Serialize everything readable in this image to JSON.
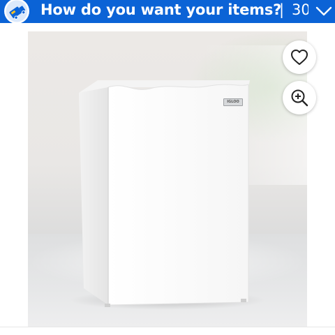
{
  "banner": {
    "question": "How do you want your items?",
    "separator": "|",
    "date_fragment": "30",
    "background_color": "#0b63d6",
    "icon": "delivery-truck-icon",
    "chevron": "chevron-down-icon"
  },
  "product": {
    "brand_badge": "IGLOO",
    "image_description_icon": "product-photo"
  },
  "actions": {
    "favorite_icon": "heart-icon",
    "zoom_icon": "zoom-in-icon"
  }
}
